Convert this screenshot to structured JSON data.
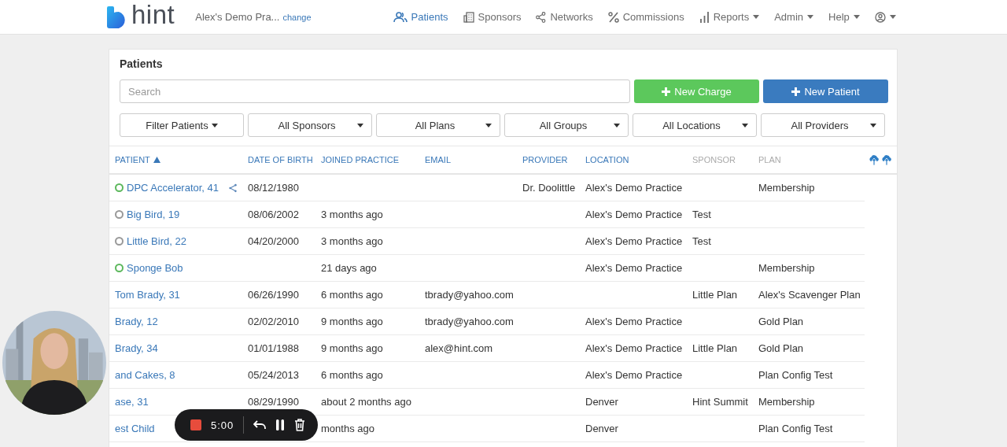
{
  "header": {
    "brand": "hint",
    "practice": "Alex's Demo Pra...",
    "change_link": "change",
    "nav": [
      {
        "label": "Patients",
        "selected": true,
        "dropdown": false
      },
      {
        "label": "Sponsors",
        "selected": false,
        "dropdown": false
      },
      {
        "label": "Networks",
        "selected": false,
        "dropdown": false
      },
      {
        "label": "Commissions",
        "selected": false,
        "dropdown": false
      },
      {
        "label": "Reports",
        "selected": false,
        "dropdown": true
      },
      {
        "label": "Admin",
        "selected": false,
        "dropdown": true
      },
      {
        "label": "Help",
        "selected": false,
        "dropdown": true
      },
      {
        "selected": false,
        "dropdown": true
      }
    ]
  },
  "panel": {
    "title": "Patients",
    "search": {
      "placeholder": "Search"
    },
    "actions": [
      {
        "label": "New Charge",
        "kind": "green"
      },
      {
        "label": "New Patient",
        "kind": "blue"
      }
    ],
    "filters": [
      {
        "label": "Filter Patients",
        "kind": "button"
      },
      {
        "label": "All Sponsors",
        "kind": "select"
      },
      {
        "label": "All Plans",
        "kind": "select"
      },
      {
        "label": "All Groups",
        "kind": "select"
      },
      {
        "label": "All Locations",
        "kind": "select"
      },
      {
        "label": "All Providers",
        "kind": "select"
      }
    ],
    "table": {
      "columns": [
        {
          "label": "PATIENT",
          "sortable": true,
          "sorted": true
        },
        {
          "label": "DATE OF BIRTH",
          "sortable": true,
          "sorted": false
        },
        {
          "label": "JOINED PRACTICE",
          "sortable": true,
          "sorted": false
        },
        {
          "label": "EMAIL",
          "sortable": true,
          "sorted": false
        },
        {
          "label": "PROVIDER",
          "sortable": true,
          "sorted": false
        },
        {
          "label": "LOCATION",
          "sortable": true,
          "sorted": false
        },
        {
          "label": "SPONSOR",
          "sortable": false
        },
        {
          "label": "PLAN",
          "sortable": false
        }
      ],
      "rows": [
        {
          "color": "#5cb85c",
          "patient": "DPC Accelerator, 41",
          "shared": true,
          "date_of_birth": "08/12/1980",
          "joined_practice": "",
          "email": "",
          "provider": "Dr. Doolittle",
          "location": "Alex's Demo Practice",
          "sponsor": "",
          "plan": "Membership"
        },
        {
          "color": "#999999",
          "patient": "Big Bird, 19",
          "date_of_birth": "08/06/2002",
          "joined_practice": "3 months ago",
          "email": "",
          "provider": "",
          "location": "Alex's Demo Practice",
          "sponsor": "Test",
          "plan": ""
        },
        {
          "color": "#999999",
          "patient": "Little Bird, 22",
          "date_of_birth": "04/20/2000",
          "joined_practice": "3 months ago",
          "email": "",
          "provider": "",
          "location": "Alex's Demo Practice",
          "sponsor": "Test",
          "plan": ""
        },
        {
          "color": "#5cb85c",
          "patient": "Sponge Bob",
          "date_of_birth": "",
          "joined_practice": "21 days ago",
          "email": "",
          "provider": "",
          "location": "Alex's Demo Practice",
          "sponsor": "",
          "plan": "Membership"
        },
        {
          "patient": "Tom Brady, 31",
          "date_of_birth": "06/26/1990",
          "joined_practice": "6 months ago",
          "email": "tbrady@yahoo.com",
          "provider": "",
          "location": "",
          "sponsor": "Little Plan",
          "plan": "Alex's Scavenger Plan"
        },
        {
          "patient": "Brady, 12",
          "date_of_birth": "02/02/2010",
          "joined_practice": "9 months ago",
          "email": "tbrady@yahoo.com",
          "provider": "",
          "location": "Alex's Demo Practice",
          "sponsor": "",
          "plan": "Gold Plan"
        },
        {
          "patient": "Brady, 34",
          "date_of_birth": "01/01/1988",
          "joined_practice": "9 months ago",
          "email": "alex@hint.com",
          "provider": "",
          "location": "Alex's Demo Practice",
          "sponsor": "Little Plan",
          "plan": "Gold Plan"
        },
        {
          "patient": "and Cakes, 8",
          "date_of_birth": "05/24/2013",
          "joined_practice": "6 months ago",
          "email": "",
          "provider": "",
          "location": "Alex's Demo Practice",
          "sponsor": "",
          "plan": "Plan Config Test"
        },
        {
          "patient": "ase, 31",
          "date_of_birth": "08/29/1990",
          "joined_practice": "about 2 months ago",
          "email": "",
          "provider": "",
          "location": "Denver",
          "sponsor": "Hint Summit",
          "plan": "Membership"
        },
        {
          "patient": "est Child",
          "date_of_birth": "",
          "joined_practice": "months ago",
          "email": "",
          "provider": "",
          "location": "Denver",
          "sponsor": "",
          "plan": "Plan Config Test"
        }
      ]
    }
  },
  "recorder": {
    "time": "5:00"
  }
}
